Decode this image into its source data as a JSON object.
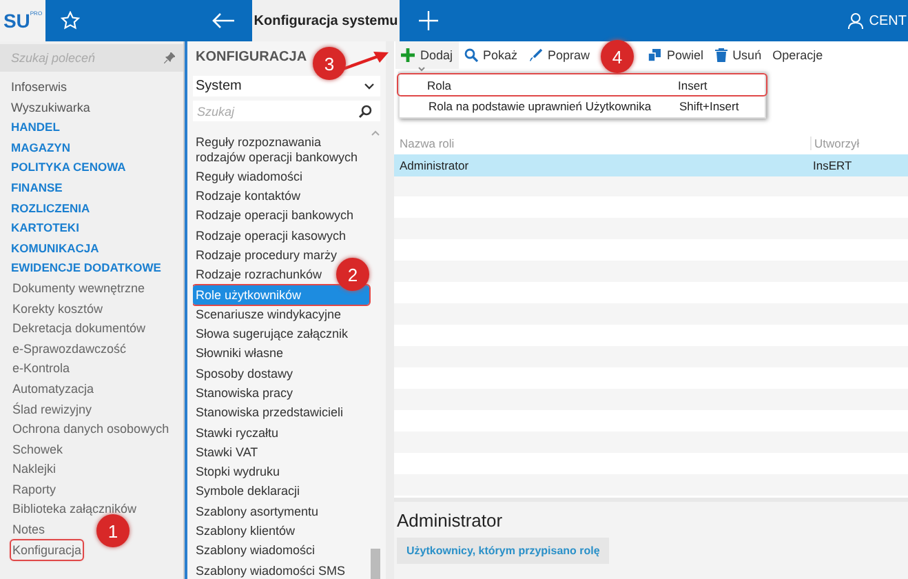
{
  "top_bar": {
    "logo": "SU",
    "logo_badge": "PRO",
    "tab": "Konfiguracja systemu",
    "user": "CENT"
  },
  "sidebar": {
    "search_placeholder": "Szukaj poleceń",
    "items": [
      {
        "label": "Infoserwis",
        "kind": "link",
        "callout": false
      },
      {
        "label": "Wyszukiwarka",
        "kind": "link",
        "callout": false
      },
      {
        "label": "HANDEL",
        "kind": "section",
        "callout": false
      },
      {
        "label": "MAGAZYN",
        "kind": "section",
        "callout": false
      },
      {
        "label": "POLITYKA CENOWA",
        "kind": "section",
        "callout": false
      },
      {
        "label": "FINANSE",
        "kind": "section",
        "callout": false
      },
      {
        "label": "ROZLICZENIA",
        "kind": "section",
        "callout": false
      },
      {
        "label": "KARTOTEKI",
        "kind": "section",
        "callout": false
      },
      {
        "label": "KOMUNIKACJA",
        "kind": "section",
        "callout": false
      },
      {
        "label": "EWIDENCJE DODATKOWE",
        "kind": "section",
        "callout": false
      },
      {
        "label": "Dokumenty wewnętrzne",
        "kind": "sub",
        "callout": false
      },
      {
        "label": "Korekty kosztów",
        "kind": "sub",
        "callout": false
      },
      {
        "label": "Dekretacja dokumentów",
        "kind": "sub",
        "callout": false
      },
      {
        "label": "e-Sprawozdawczość",
        "kind": "sub",
        "callout": false
      },
      {
        "label": "e-Kontrola",
        "kind": "sub",
        "callout": false
      },
      {
        "label": "Automatyzacja",
        "kind": "sub",
        "callout": false
      },
      {
        "label": "Ślad rewizyjny",
        "kind": "sub",
        "callout": false
      },
      {
        "label": "Ochrona danych osobowych",
        "kind": "sub",
        "callout": false
      },
      {
        "label": "Schowek",
        "kind": "sub",
        "callout": false
      },
      {
        "label": "Naklejki",
        "kind": "sub",
        "callout": false
      },
      {
        "label": "Raporty",
        "kind": "sub",
        "callout": false
      },
      {
        "label": "Biblioteka załączników",
        "kind": "sub",
        "callout": false
      },
      {
        "label": "Notes",
        "kind": "sub",
        "callout": false
      },
      {
        "label": "Konfiguracja",
        "kind": "sub",
        "callout": true
      }
    ]
  },
  "config": {
    "title": "KONFIGURACJA",
    "dropdown": "System",
    "search_placeholder": "Szukaj",
    "items": [
      {
        "label": "Reguły rozpoznawania rodzajów operacji bankowych",
        "selected": false,
        "callout": false
      },
      {
        "label": "Reguły wiadomości",
        "selected": false,
        "callout": false
      },
      {
        "label": "Rodzaje kontaktów",
        "selected": false,
        "callout": false
      },
      {
        "label": "Rodzaje operacji bankowych",
        "selected": false,
        "callout": false
      },
      {
        "label": "Rodzaje operacji kasowych",
        "selected": false,
        "callout": false
      },
      {
        "label": "Rodzaje procedury marży",
        "selected": false,
        "callout": false
      },
      {
        "label": "Rodzaje rozrachunków",
        "selected": false,
        "callout": false
      },
      {
        "label": "Role użytkowników",
        "selected": true,
        "callout": true
      },
      {
        "label": "Scenariusze windykacyjne",
        "selected": false,
        "callout": false
      },
      {
        "label": "Słowa sugerujące załącznik",
        "selected": false,
        "callout": false
      },
      {
        "label": "Słowniki własne",
        "selected": false,
        "callout": false
      },
      {
        "label": "Sposoby dostawy",
        "selected": false,
        "callout": false
      },
      {
        "label": "Stanowiska pracy",
        "selected": false,
        "callout": false
      },
      {
        "label": "Stanowiska przedstawicieli",
        "selected": false,
        "callout": false
      },
      {
        "label": "Stawki ryczałtu",
        "selected": false,
        "callout": false
      },
      {
        "label": "Stawki VAT",
        "selected": false,
        "callout": false
      },
      {
        "label": "Stopki wydruku",
        "selected": false,
        "callout": false
      },
      {
        "label": "Symbole deklaracji",
        "selected": false,
        "callout": false
      },
      {
        "label": "Szablony asortymentu",
        "selected": false,
        "callout": false
      },
      {
        "label": "Szablony klientów",
        "selected": false,
        "callout": false
      },
      {
        "label": "Szablony wiadomości",
        "selected": false,
        "callout": false
      },
      {
        "label": "Szablony wiadomości SMS",
        "selected": false,
        "callout": false
      }
    ]
  },
  "toolbar": [
    {
      "label": "Dodaj",
      "kind": "add"
    },
    {
      "label": "Pokaż",
      "kind": "show"
    },
    {
      "label": "Popraw",
      "kind": "edit"
    },
    {
      "label": "Powiel",
      "kind": "copy"
    },
    {
      "label": "Usuń",
      "kind": "delete"
    },
    {
      "label": "Operacje",
      "kind": "plain"
    }
  ],
  "menu": [
    {
      "label": "Rola",
      "shortcut": "Insert",
      "callout": true
    },
    {
      "label": "Rola na podstawie uprawnień Użytkownika",
      "shortcut": "Shift+Insert",
      "callout": false
    }
  ],
  "table": {
    "columns": [
      "Nazwa roli",
      "Utworzył"
    ],
    "rows": [
      {
        "cells": [
          "Administrator",
          "InsERT"
        ],
        "selected": true
      }
    ]
  },
  "details": {
    "title": "Administrator",
    "tab": "Użytkownicy, którym przypisano rolę"
  },
  "annotations": [
    {
      "number": "1"
    },
    {
      "number": "2"
    },
    {
      "number": "3"
    },
    {
      "number": "4"
    }
  ]
}
